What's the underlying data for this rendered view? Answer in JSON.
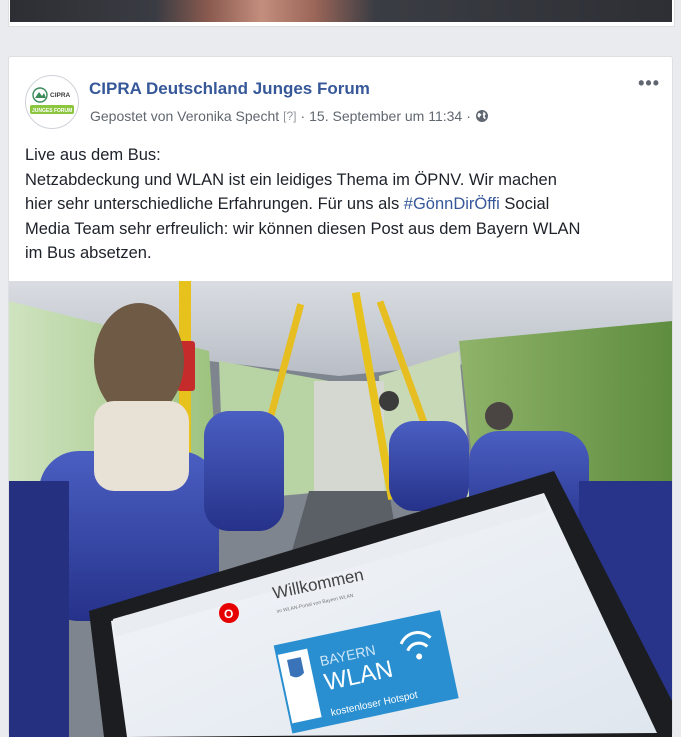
{
  "page": {
    "name": "CIPRA Deutschland Junges Forum",
    "posted_by": "Gepostet von Veronika Specht",
    "help_marker": "[?]",
    "separator": "·",
    "date": "15. September um 11:34",
    "privacy_icon": "globe-icon",
    "more_icon": "more-options-icon",
    "more_label": "•••"
  },
  "avatar": {
    "brand_top": "CIPRA",
    "brand_bottom": "JUNGES FORUM"
  },
  "post": {
    "line1": "Live aus dem Bus:",
    "line2": "Netzabdeckung und WLAN ist ein leidiges Thema im ÖPNV. Wir machen",
    "line3": "hier sehr unterschiedliche Erfahrungen. Für uns als ",
    "hashtag": "#GönnDirÖffi",
    "line3_after": " Social",
    "line4": "Media Team sehr erfreulich: wir können diesen Post aus dem Bayern WLAN",
    "line5": "im Bus absetzen."
  },
  "photo_content": {
    "welcome": "Willkommen",
    "subtitle": "im WLAN-Portal von Bayern WLAN",
    "badge_line1": "BAYERN",
    "badge_line2": "WLAN",
    "badge_tag": "kostenloser Hotspot"
  },
  "colors": {
    "link": "#365899",
    "text": "#1d2129",
    "meta": "#606770",
    "bayern_blue": "#2a8fd0",
    "vodafone_red": "#e60000"
  }
}
